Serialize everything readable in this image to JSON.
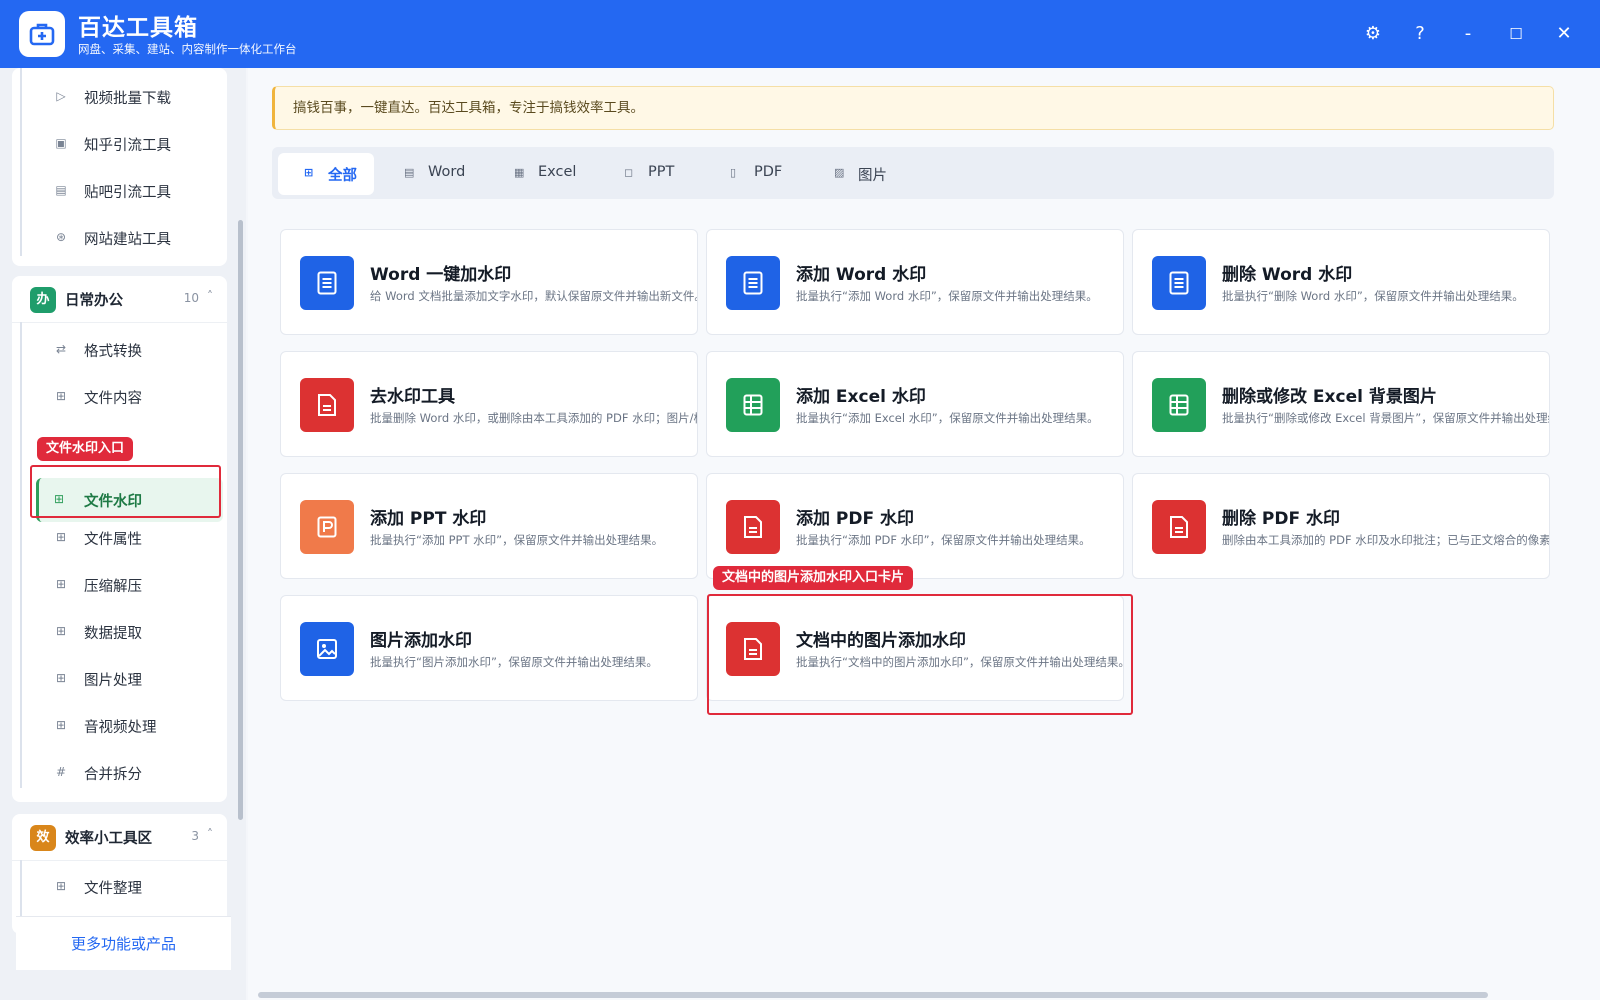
{
  "app": {
    "title": "百达工具箱",
    "subtitle": "网盘、采集、建站、内容制作一体化工作台"
  },
  "window_controls": {
    "settings": "⚙",
    "help": "?",
    "minimize": "-",
    "maximize": "☐",
    "close": "✕"
  },
  "sidebar": {
    "top_items": [
      {
        "label": "视频批量下载",
        "icon": "video-icon"
      },
      {
        "label": "知乎引流工具",
        "icon": "zhihu-icon"
      },
      {
        "label": "贴吧引流工具",
        "icon": "tieba-icon"
      },
      {
        "label": "网站建站工具",
        "icon": "globe-icon"
      }
    ],
    "groups": [
      {
        "badge": "办",
        "badge_color": "#1f9d6b",
        "title": "日常办公",
        "count": "10",
        "caret": "˄",
        "items": [
          {
            "label": "格式转换",
            "icon": "swap-icon"
          },
          {
            "label": "文件内容",
            "icon": "grid-icon"
          },
          {
            "label": "文件水印",
            "icon": "grid-icon",
            "active": true
          },
          {
            "label": "文件属性",
            "icon": "grid-icon"
          },
          {
            "label": "压缩解压",
            "icon": "grid-icon"
          },
          {
            "label": "数据提取",
            "icon": "grid-icon"
          },
          {
            "label": "图片处理",
            "icon": "grid-icon"
          },
          {
            "label": "音视频处理",
            "icon": "grid-icon"
          },
          {
            "label": "合并拆分",
            "icon": "hash-icon"
          }
        ]
      },
      {
        "badge": "效",
        "badge_color": "#d9861a",
        "title": "效率小工具区",
        "count": "3",
        "caret": "˄",
        "items": [
          {
            "label": "文件整理",
            "icon": "grid-icon"
          }
        ]
      }
    ],
    "annotation_tag": "文件水印入口",
    "footer": "更多功能或产品"
  },
  "main": {
    "notice": "搞钱百事，一键直达。百达工具箱，专注于搞钱效率工具。",
    "tabs": [
      {
        "label": "全部",
        "icon": "grid-icon",
        "active": true
      },
      {
        "label": "Word",
        "icon": "doc-icon"
      },
      {
        "label": "Excel",
        "icon": "table-icon"
      },
      {
        "label": "PPT",
        "icon": "ppt-icon"
      },
      {
        "label": "PDF",
        "icon": "pdf-icon"
      },
      {
        "label": "图片",
        "icon": "image-icon"
      }
    ],
    "cards": [
      {
        "title": "Word 一键加水印",
        "desc": "给 Word 文档批量添加文字水印，默认保留原文件并输出新文件。",
        "icon": "word-doc-icon",
        "color": "#1f63e6"
      },
      {
        "title": "添加 Word 水印",
        "desc": "批量执行“添加 Word 水印”，保留原文件并输出处理结果。",
        "icon": "word-doc-icon",
        "color": "#1f63e6"
      },
      {
        "title": "删除 Word 水印",
        "desc": "批量执行“删除 Word 水印”，保留原文件并输出处理结果。",
        "icon": "word-doc-icon",
        "color": "#1f63e6"
      },
      {
        "title": "去水印工具",
        "desc": "批量删除 Word 水印，或删除由本工具添加的 PDF 水印；图片/标",
        "icon": "pdf-doc-icon",
        "color": "#dc3232"
      },
      {
        "title": "添加 Excel 水印",
        "desc": "批量执行“添加 Excel 水印”，保留原文件并输出处理结果。",
        "icon": "excel-table-icon",
        "color": "#22a05a"
      },
      {
        "title": "删除或修改 Excel 背景图片",
        "desc": "批量执行“删除或修改 Excel 背景图片”，保留原文件并输出处理结果。",
        "icon": "excel-table-icon",
        "color": "#22a05a"
      },
      {
        "title": "添加 PPT 水印",
        "desc": "批量执行“添加 PPT 水印”，保留原文件并输出处理结果。",
        "icon": "ppt-slide-icon",
        "color": "#f07a4a"
      },
      {
        "title": "添加 PDF 水印",
        "desc": "批量执行“添加 PDF 水印”，保留原文件并输出处理结果。",
        "icon": "pdf-doc-icon",
        "color": "#dc3232"
      },
      {
        "title": "删除 PDF 水印",
        "desc": "删除由本工具添加的 PDF 水印及水印批注；已与正文熔合的像素水印",
        "icon": "pdf-doc-icon",
        "color": "#dc3232"
      },
      {
        "title": "图片添加水印",
        "desc": "批量执行“图片添加水印”，保留原文件并输出处理结果。",
        "icon": "image-frame-icon",
        "color": "#1f63e6"
      },
      {
        "title": "文档中的图片添加水印",
        "desc": "批量执行“文档中的图片添加水印”，保留原文件并输出处理结果。",
        "icon": "pdf-doc-icon",
        "color": "#dc3232"
      }
    ],
    "annotation_tag": "文档中的图片添加水印入口卡片"
  }
}
